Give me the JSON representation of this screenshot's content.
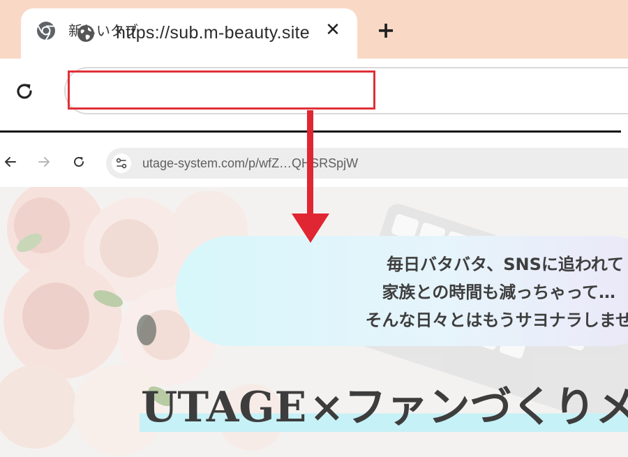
{
  "browser_top": {
    "tab": {
      "title": "新しいタブ",
      "close_glyph": "✕",
      "icon": "chrome-logo-icon"
    },
    "new_tab_glyph": "+",
    "url": "https://sub.m-beauty.site"
  },
  "browser_lower": {
    "back_glyph": "←",
    "forward_glyph": "→",
    "url": "utage-system.com/p/wfZ…QHSRSpjW"
  },
  "hero": {
    "bubble_lines": [
      "毎日バタバタ、SNSに追われて",
      "家族との時間も減っちゃって…",
      "そんな日々とはもうサヨナラしませんか"
    ],
    "headline_part1": "UTAGE",
    "headline_part2": "×ファンづくりメ"
  },
  "colors": {
    "tab_strip": "#f9d9c6",
    "highlight_box": "#e03038",
    "arrow": "#e02632",
    "bubble_start": "#d7f7fb",
    "bubble_end": "#ece7f8",
    "headline_marker": "#c6f1f6"
  }
}
